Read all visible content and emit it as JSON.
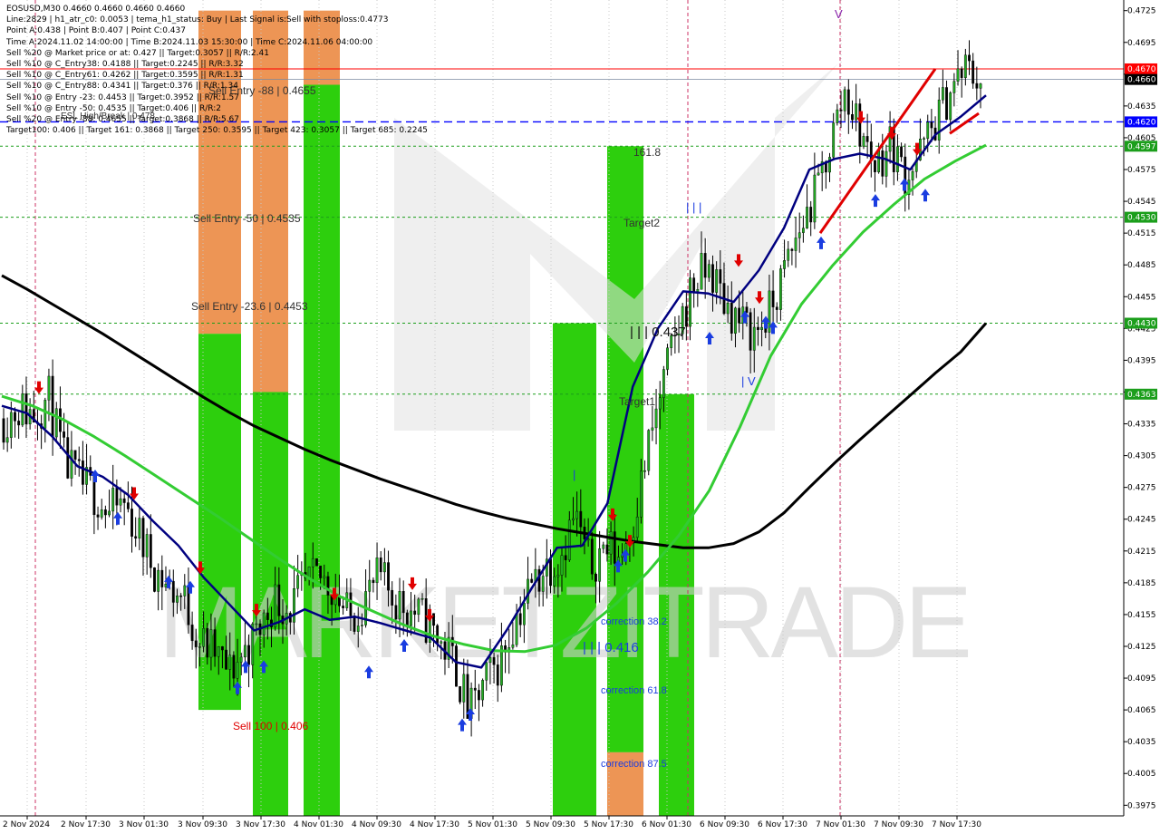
{
  "header": {
    "symbol_line": "EOSUSD,M30  0.4660 0.4660 0.4660 0.4660",
    "lines": [
      "Line:2829 | h1_atr_c0: 0.0053 | tema_h1_status: Buy | Last Signal is:Sell with stoploss:0.4773",
      "Point A:0.438 | Point B:0.407 | Point C:0.437",
      "Time A:2024.11.02 14:00:00 | Time B:2024.11.03 15:30:00 | Time C:2024.11.06 04:00:00",
      "Sell %20 @ Market price or at: 0.427 || Target:0.3057 || R/R:2.41",
      "Sell %10 @ C_Entry38: 0.4188 || Target:0.2245 || R/R:3.32",
      "Sell %10 @ C_Entry61: 0.4262 || Target:0.3595 || R/R:1.31",
      "Sell %10 @ C_Entry88: 0.4341 || Target:0.376 || R/R:1.34",
      "Sell %10 @ Entry -23: 0.4453 || Target:0.3952 || R/R:1.57",
      "Sell %10 @ Entry -50: 0.4535 || Target:0.406 || R/R:2",
      "Sell %20 @ Entry -88: 0.4655 || Target:0.3868 || R/R:5.67",
      "Target100: 0.406 || Target 161: 0.3868 || Target 250: 0.3595 || Target 423: 0.3057 || Target 685: 0.2245"
    ]
  },
  "watermark": "MARKETZITRADE",
  "annotations": {
    "sell_entry_88": "Sell Entry -88 | 0.4655",
    "sell_entry_50": "Sell Entry -50 | 0.4535",
    "sell_entry_23": "Sell Entry -23.6 | 0.4453",
    "sell_100": "Sell 100 | 0.406",
    "esl_high": "ESL High/Break | 0.478",
    "fib_1618": "161.8",
    "target2": "Target2",
    "target1": "Target1",
    "point_c": "| | | 0.437",
    "point_b": "| | | 0.416",
    "corr_382": "correction 38.2",
    "corr_618": "correction 61.8",
    "corr_875": "correction 87.5",
    "wave_1": "|",
    "wave_3": "| | |",
    "wave_4": "| V",
    "wave_5": "V"
  },
  "colors": {
    "price_tag_red": "#ff0000",
    "price_tag_blue": "#0000ff",
    "price_tag_green": "#1b9e1b",
    "price_tag_black": "#000000",
    "zone_green": "#22cc00",
    "zone_orange": "#e87a2a",
    "ema_black": "#000000",
    "ema_navy": "#000080",
    "ema_green": "#33cc33"
  },
  "chart_data": {
    "type": "candlestick",
    "symbol": "EOSUSD",
    "timeframe": "M30",
    "ylim": [
      0.3965,
      0.4735
    ],
    "y_ticks": [
      "0.4725",
      "0.4695",
      "0.4665",
      "0.4635",
      "0.4605",
      "0.4575",
      "0.4545",
      "0.4515",
      "0.4485",
      "0.4455",
      "0.4425",
      "0.4395",
      "0.4365",
      "0.4335",
      "0.4305",
      "0.4275",
      "0.4245",
      "0.4215",
      "0.4185",
      "0.4155",
      "0.4125",
      "0.4095",
      "0.4065",
      "0.4035",
      "0.4005",
      "0.3975"
    ],
    "x_labels": [
      "2 Nov 2024",
      "2 Nov 17:30",
      "3 Nov 01:30",
      "3 Nov 09:30",
      "3 Nov 17:30",
      "4 Nov 01:30",
      "4 Nov 09:30",
      "4 Nov 17:30",
      "5 Nov 01:30",
      "5 Nov 09:30",
      "5 Nov 17:30",
      "6 Nov 01:30",
      "6 Nov 09:30",
      "6 Nov 17:30",
      "7 Nov 01:30",
      "7 Nov 09:30",
      "7 Nov 17:30"
    ],
    "current_price": 0.466,
    "horizontal_levels": [
      {
        "label": "0.4670",
        "value": 0.467,
        "kind": "sell-stop",
        "color": "#ff0000"
      },
      {
        "label": "0.4660",
        "value": 0.466,
        "kind": "current",
        "color": "#000000"
      },
      {
        "label": "0.4620",
        "value": 0.462,
        "kind": "entry",
        "color": "#0000ff"
      },
      {
        "label": "0.4597",
        "value": 0.4597,
        "kind": "target",
        "color": "#1b9e1b"
      },
      {
        "label": "0.4530",
        "value": 0.453,
        "kind": "target",
        "color": "#1b9e1b"
      },
      {
        "label": "0.4430",
        "value": 0.443,
        "kind": "target",
        "color": "#1b9e1b"
      },
      {
        "label": "0.4363",
        "value": 0.4363,
        "kind": "target",
        "color": "#1b9e1b"
      }
    ],
    "series": [
      {
        "name": "close",
        "values": [
          0.434,
          0.435,
          0.4345,
          0.436,
          0.43,
          0.428,
          0.427,
          0.425,
          0.426,
          0.423,
          0.42,
          0.418,
          0.417,
          0.413,
          0.412,
          0.41,
          0.412,
          0.414,
          0.417,
          0.416,
          0.418,
          0.419,
          0.418,
          0.415,
          0.417,
          0.419,
          0.417,
          0.416,
          0.415,
          0.413,
          0.411,
          0.406,
          0.409,
          0.411,
          0.415,
          0.418,
          0.42,
          0.421,
          0.425,
          0.42,
          0.422,
          0.421,
          0.425,
          0.432,
          0.438,
          0.443,
          0.447,
          0.448,
          0.445,
          0.443,
          0.442,
          0.444,
          0.448,
          0.452,
          0.455,
          0.46,
          0.465,
          0.461,
          0.458,
          0.46,
          0.457,
          0.459,
          0.462,
          0.465,
          0.467,
          0.466
        ]
      },
      {
        "name": "ema_slow",
        "values": [
          0.4475,
          0.4462,
          0.4448,
          0.4434,
          0.442,
          0.4405,
          0.439,
          0.4375,
          0.436,
          0.4346,
          0.4333,
          0.4322,
          0.4311,
          0.4301,
          0.4292,
          0.4283,
          0.4275,
          0.4267,
          0.4259,
          0.4252,
          0.4246,
          0.4241,
          0.4236,
          0.4232,
          0.4228,
          0.4224,
          0.4221,
          0.4218,
          0.4218,
          0.4222,
          0.4233,
          0.4251,
          0.4275,
          0.4298,
          0.432,
          0.4341,
          0.4362,
          0.4383,
          0.4403,
          0.443
        ]
      },
      {
        "name": "ema_mid",
        "values": [
          0.4361,
          0.4352,
          0.4339,
          0.4323,
          0.4305,
          0.4286,
          0.4267,
          0.4248,
          0.4228,
          0.4208,
          0.4189,
          0.4172,
          0.4159,
          0.4146,
          0.4135,
          0.4127,
          0.4121,
          0.412,
          0.4126,
          0.4142,
          0.4166,
          0.4195,
          0.4229,
          0.4272,
          0.4332,
          0.4399,
          0.4448,
          0.4484,
          0.4516,
          0.4542,
          0.4566,
          0.4583,
          0.4598
        ]
      },
      {
        "name": "ema_fast",
        "values": [
          0.4352,
          0.4345,
          0.4323,
          0.4295,
          0.4285,
          0.4268,
          0.4243,
          0.422,
          0.419,
          0.4165,
          0.414,
          0.4148,
          0.416,
          0.415,
          0.4153,
          0.4147,
          0.414,
          0.4133,
          0.411,
          0.4105,
          0.414,
          0.418,
          0.4218,
          0.422,
          0.426,
          0.437,
          0.4425,
          0.446,
          0.4458,
          0.445,
          0.448,
          0.452,
          0.4575,
          0.4585,
          0.459,
          0.4585,
          0.4575,
          0.4608,
          0.4625,
          0.4645
        ]
      }
    ]
  }
}
